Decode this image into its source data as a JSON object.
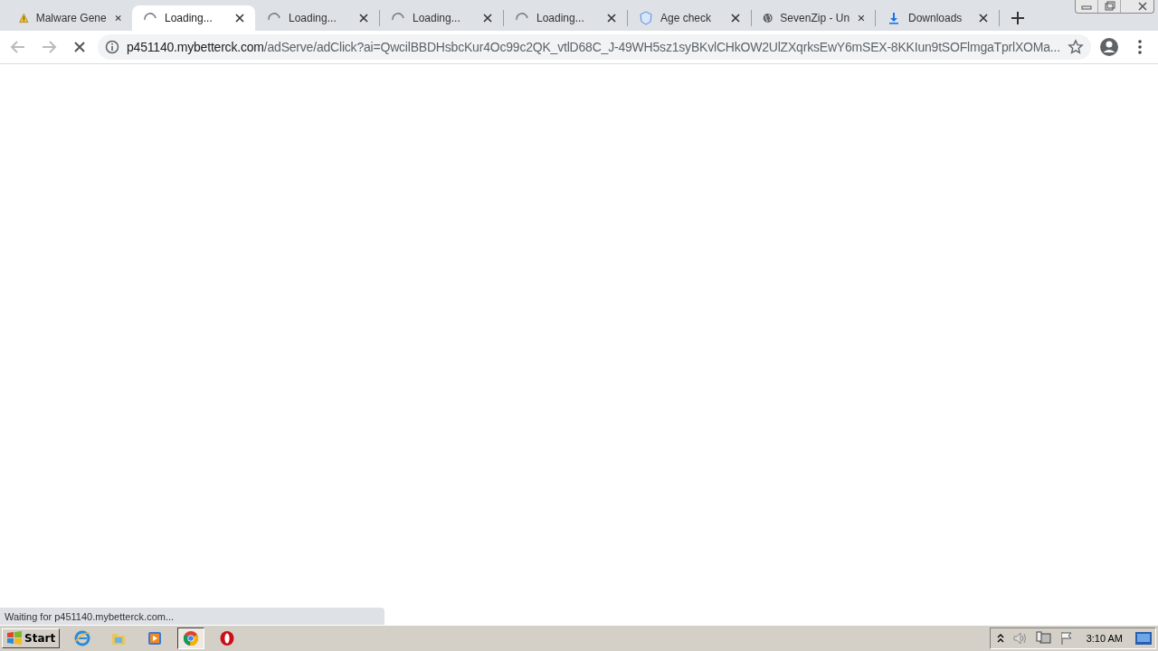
{
  "tabs": [
    {
      "label": "Malware Gene",
      "selected": false
    },
    {
      "label": "Loading...",
      "selected": true
    },
    {
      "label": "Loading...",
      "selected": false
    },
    {
      "label": "Loading...",
      "selected": false
    },
    {
      "label": "Loading...",
      "selected": false
    },
    {
      "label": "Age check",
      "selected": false
    },
    {
      "label": "SevenZip - Un",
      "selected": false
    },
    {
      "label": "Downloads",
      "selected": false
    }
  ],
  "address_bar": {
    "host": "p451140.mybetterck.com",
    "path": "/adServe/adClick?ai=QwcilBBDHsbcKur4Oc99c2QK_vtlD68C_J-49WH5sz1syBKvlCHkOW2UlZXqrksEwY6mSEX-8KKIun9tSOFlmgaTprlXOMa..."
  },
  "status_bubble": "Waiting for p451140.mybetterck.com...",
  "taskbar": {
    "start": "Start",
    "items": [
      {
        "selected": false
      },
      {
        "selected": false
      },
      {
        "selected": false
      },
      {
        "selected": true
      },
      {
        "selected": false
      }
    ],
    "clock": "3:10 AM"
  }
}
